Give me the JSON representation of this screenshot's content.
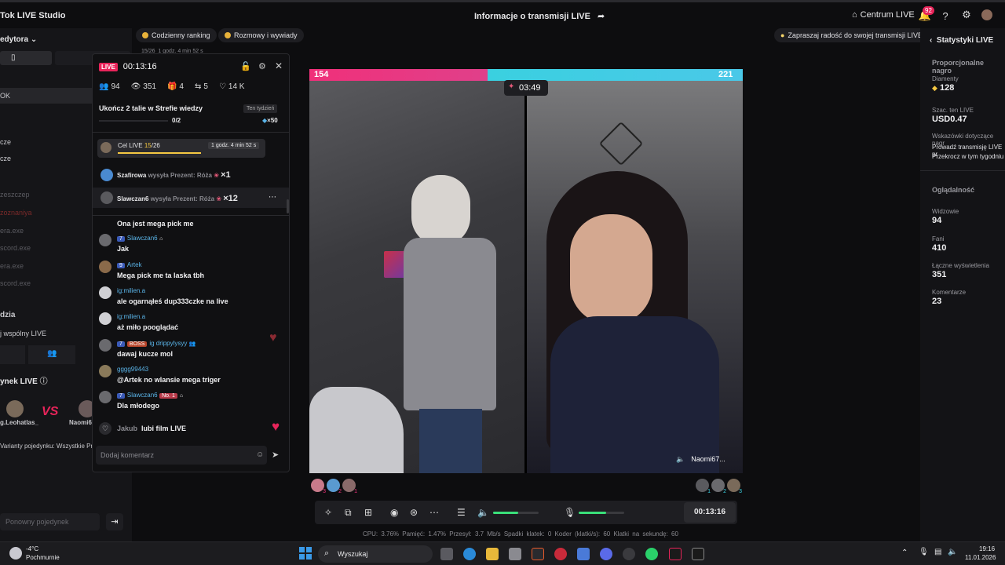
{
  "app": {
    "title": "Tok LIVE Studio",
    "live_info": "Informacje o transmisji LIVE",
    "centrum": "Centrum LIVE",
    "notifications": "92"
  },
  "left_panel": {
    "header": "edytora",
    "items": [
      "OK",
      "cze",
      "cze",
      "zeszczep",
      "zoznaniya",
      "era.exe",
      "scord.exe",
      "era.exe",
      "scord.exe"
    ],
    "section2": "dzia",
    "shared_live": "j wspólny LIVE",
    "battle_title": "ynek LIVE",
    "battle_left": "g.Leohatlas_",
    "battle_right": "Naomi67",
    "battle_variants": "Varianty pojedynku: Wszystkie Prezenty",
    "rematch": "Ponowny pojedynek"
  },
  "pills": {
    "daily_ranking": "Codzienny ranking",
    "chat_rank": "Rozmowy i wywiady",
    "invite": "Zapraszaj radość do swojej transmisji LIVE"
  },
  "chat": {
    "live_label": "LIVE",
    "timer": "00:13:16",
    "stats": {
      "viewers": "94",
      "views": "351",
      "gifts": "4",
      "shares": "5",
      "likes": "14 K"
    },
    "quest": {
      "title": "Ukończ 2 talie w Strefie wiedzy",
      "period": "Ten tydzień",
      "progress": "0/2",
      "reward": "×50"
    },
    "goal": {
      "label": "Cel LIVE",
      "current": "15",
      "total": "/26",
      "remaining": "1 godz. 4 min 52 s"
    },
    "overlay_goal_text": "15/26",
    "overlay_time": "1 godz. 4 min 52 s",
    "gifts": [
      {
        "user": "Szafirowa",
        "text": "wysyła Prezent: Róża",
        "count": "×1"
      },
      {
        "user": "Slawczan6",
        "text": "wysyła Prezent: Róża",
        "count": "×12"
      }
    ],
    "messages": [
      {
        "user": "",
        "text": "Ona jest mega pick me"
      },
      {
        "user": "Slawczan6",
        "level": "7",
        "text": "Jak"
      },
      {
        "user": "Artek",
        "level": "9",
        "text": "Mega pick me ta laska tbh"
      },
      {
        "user": "ig:milien.a",
        "text": "ale ogarnąłeś dup333czke na live"
      },
      {
        "user": "ig:milien.a",
        "text": "aż miło pooglądać"
      },
      {
        "user": "ig drippylysyy",
        "level": "7",
        "boss": "BOSS",
        "text": "dawaj kucze mol"
      },
      {
        "user": "gggg99443",
        "text": "@Artek no wlansie mega triger"
      },
      {
        "user": "Slawczan6",
        "level": "7",
        "rank": "No. 1",
        "text": "Dla młodego"
      }
    ],
    "like_event": {
      "user": "Jakub",
      "text": "lubi film LIVE"
    },
    "input_placeholder": "Dodaj komentarz"
  },
  "video": {
    "score_left": "154",
    "score_right": "221",
    "battle_timer": "03:49",
    "right_name": "Naomi67...",
    "left_ranks": [
      "3",
      "2",
      "1"
    ],
    "right_ranks": [
      "1",
      "2",
      "3"
    ],
    "colors": {
      "left": "#f0307a",
      "right": "#3ad0e0"
    }
  },
  "controls": {
    "timer": "00:13:16",
    "volume": 0.55,
    "mic": 0.6
  },
  "status": "CPU: 3.76%  Pamięć: 1.47%  Przesył: 3.7 Mb/s  Spadki klatek: 0  Koder (klatki/s): 60  Klatki na sekundę: 60",
  "right_panel": {
    "title": "Statystyki LIVE",
    "section1": "Proporcjonalne nagro",
    "diamonds_label": "Diamenty",
    "diamonds": "128",
    "est_label": "Szac. ten LIVE",
    "est": "USD0.47",
    "tips_label": "Wskazówki dotyczące nagr",
    "tip1": "Prowadź transmisję LIVE pr",
    "tip2": "Przekrocz w tym tygodniu",
    "section2": "Oglądalność",
    "viewers_label": "Widzowie",
    "viewers": "94",
    "fans_label": "Fani",
    "fans": "410",
    "views_label": "Łączne wyświetlenia",
    "views": "351",
    "comments_label": "Komentarze",
    "comments": "23"
  },
  "taskbar": {
    "weather_temp": "-4°C",
    "weather_desc": "Pochmurnie",
    "search": "Wyszukaj",
    "time": "19:16",
    "date": "11.01.2026"
  }
}
